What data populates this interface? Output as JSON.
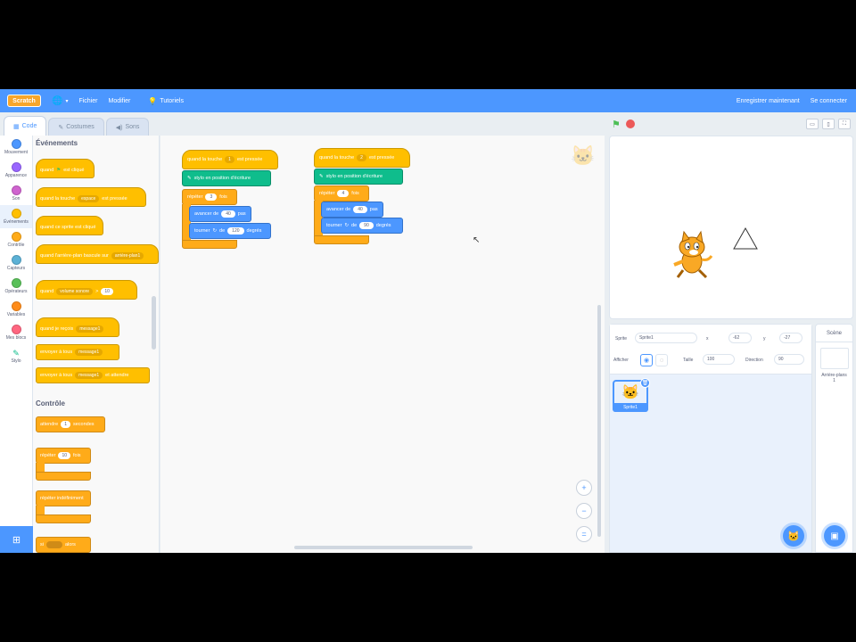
{
  "menu": {
    "logo": "Scratch",
    "globe_icon": "globe-icon",
    "file": "Fichier",
    "edit": "Modifier",
    "tutorials": "Tutoriels",
    "right1": "Enregistrer maintenant",
    "right2": "Se connecter"
  },
  "tabs": {
    "code": "Code",
    "costumes": "Costumes",
    "sounds": "Sons"
  },
  "categories": [
    {
      "label": "Mouvement",
      "color": "#4c97ff"
    },
    {
      "label": "Apparence",
      "color": "#9966ff"
    },
    {
      "label": "Son",
      "color": "#cf63cf"
    },
    {
      "label": "Événements",
      "color": "#ffbf00"
    },
    {
      "label": "Contrôle",
      "color": "#ffab19"
    },
    {
      "label": "Capteurs",
      "color": "#5cb1d6"
    },
    {
      "label": "Opérateurs",
      "color": "#59c059"
    },
    {
      "label": "Variables",
      "color": "#ff8c1a"
    },
    {
      "label": "Mes blocs",
      "color": "#ff6680"
    },
    {
      "label": "Stylo",
      "color": "#0fbd8c"
    }
  ],
  "palette": {
    "events_title": "Événements",
    "b1": "quand",
    "b1_tail": "est cliqué",
    "b2": "quand la touche",
    "b2_dd": "espace",
    "b2_tail": "est pressée",
    "b3": "quand ce sprite est cliqué",
    "b4": "quand l'arrière-plan bascule sur",
    "b4_dd": "arrière-plan1",
    "b5": "quand",
    "b5_dd": "volume sonore",
    "b5_tail": ">",
    "b5_val": "10",
    "b6": "quand je reçois",
    "b6_dd": "message1",
    "b7": "envoyer à tous",
    "b7_dd": "message1",
    "b8": "envoyer à tous",
    "b8_dd": "message1",
    "b8_tail": "et attendre",
    "control_title": "Contrôle",
    "c1": "attendre",
    "c1_val": "1",
    "c1_tail": "secondes",
    "c2": "répéter",
    "c2_val": "10",
    "c2_tail": "fois",
    "c3": "répéter indéfiniment",
    "c4": "si",
    "c4_tail": "alors"
  },
  "script1": {
    "hat": "quand la touche",
    "hat_dd": "1",
    "hat_tail": "est pressée",
    "pen": "stylo en position d'écriture",
    "repeat": "répéter",
    "repeat_val": "3",
    "repeat_tail": "fois",
    "move": "avancer de",
    "move_val": "40",
    "move_tail": "pas",
    "turn": "tourner",
    "turn_de": "de",
    "turn_val": "120",
    "turn_tail": "degrés"
  },
  "script2": {
    "hat": "quand la touche",
    "hat_dd": "2",
    "hat_tail": "est pressée",
    "pen": "stylo en position d'écriture",
    "repeat": "répéter",
    "repeat_val": "4",
    "repeat_tail": "fois",
    "move": "avancer de",
    "move_val": "40",
    "move_tail": "pas",
    "turn": "tourner",
    "turn_de": "de",
    "turn_val": "90",
    "turn_tail": "degrés"
  },
  "sprite_info": {
    "sprite_label": "Sprite",
    "sprite_name": "Sprite1",
    "x_label": "x",
    "x_val": "-62",
    "y_label": "y",
    "y_val": "-27",
    "show_label": "Afficher",
    "size_label": "Taille",
    "size_val": "100",
    "direction_label": "Direction",
    "direction_val": "90"
  },
  "sprite_card": {
    "name": "Sprite1"
  },
  "stage_pane": {
    "title": "Scène",
    "backdrops_label": "Arrière-plans",
    "backdrops_count": "1"
  }
}
